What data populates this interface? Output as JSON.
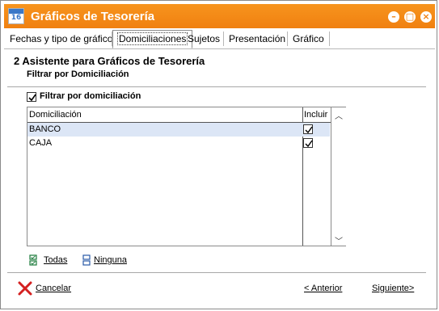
{
  "window": {
    "title": "Gráficos de Tesorería",
    "app_icon_number": "16",
    "accent_color": "#f08010"
  },
  "tabs": [
    {
      "label": "Fechas y tipo de gráfico",
      "active": false
    },
    {
      "label": "Domiciliaciones",
      "active": true
    },
    {
      "label": "Sujetos",
      "active": false
    },
    {
      "label": "Presentación",
      "active": false
    },
    {
      "label": "Gráfico",
      "active": false
    }
  ],
  "step": {
    "title": "2 Asistente para Gráficos de Tesorería",
    "subtitle": "Filtrar por Domiciliación"
  },
  "filter": {
    "label": "Filtrar por domiciliación",
    "checked": true
  },
  "grid": {
    "columns": [
      "Domiciliación",
      "Incluir"
    ],
    "rows": [
      {
        "name": "BANCO",
        "include": true,
        "selected": true
      },
      {
        "name": "CAJA",
        "include": true,
        "selected": false
      }
    ]
  },
  "selection_links": {
    "all": "Todas",
    "none": "Ninguna"
  },
  "footer": {
    "cancel": "Cancelar",
    "previous": "< Anterior",
    "next": "Siguiente>"
  }
}
